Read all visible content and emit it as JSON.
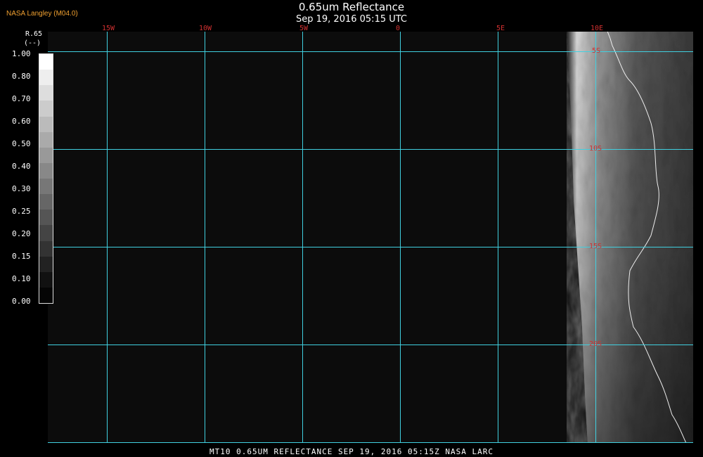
{
  "header": {
    "brand": "NASA Langley (M04.0)",
    "title": "0.65um Reflectance",
    "subtitle": "Sep 19, 2016 05:15 UTC"
  },
  "colorbar": {
    "variable": "R.65",
    "units": "(--)",
    "ticks": [
      "1.00",
      "0.80",
      "0.70",
      "0.60",
      "0.50",
      "0.40",
      "0.30",
      "0.25",
      "0.20",
      "0.15",
      "0.10",
      "0.00"
    ],
    "shades": [
      "#ffffff",
      "#eeeeee",
      "#dddddd",
      "#cccccc",
      "#bbbbbb",
      "#aaaaaa",
      "#999999",
      "#888888",
      "#777777",
      "#666666",
      "#555555",
      "#444444",
      "#333333",
      "#222222",
      "#111111",
      "#050505"
    ]
  },
  "grid": {
    "longitudes": [
      "15W",
      "10W",
      "5W",
      "0",
      "5E",
      "10E"
    ],
    "latitudes": [
      "5S",
      "10S",
      "15S",
      "20S"
    ],
    "line_color": "#40d0e0",
    "label_color": "#d03030"
  },
  "footer": {
    "text": "MT10  0.65UM REFLECTANCE   SEP 19, 2016 05:15Z   NASA LARC"
  }
}
